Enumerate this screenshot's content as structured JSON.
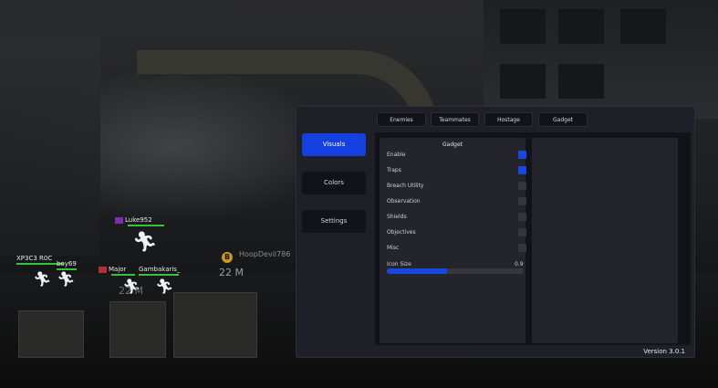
{
  "players": [
    {
      "name": "XP3C3 R0C",
      "name2": "boy69"
    },
    {
      "name": "Luke952"
    },
    {
      "name": "Major",
      "name2": "Gambakaris_"
    },
    {
      "name": "HoopDevil786"
    }
  ],
  "scene": {
    "distance_1": "22 M",
    "distance_2": "22 M",
    "objective_letter": "B"
  },
  "sidebar": {
    "items": [
      {
        "label": "Visuals",
        "active": true
      },
      {
        "label": "Colors",
        "active": false
      },
      {
        "label": "Settings",
        "active": false
      }
    ]
  },
  "tabs": [
    "Enemies",
    "Teammates",
    "Hostage",
    "Gadget"
  ],
  "gadget": {
    "title": "Gadget",
    "options": [
      {
        "label": "Enable",
        "checked": true
      },
      {
        "label": "Traps",
        "checked": true
      },
      {
        "label": "Breach Utility",
        "checked": false
      },
      {
        "label": "Observation",
        "checked": false
      },
      {
        "label": "Shields",
        "checked": false
      },
      {
        "label": "Objectives",
        "checked": false
      },
      {
        "label": "Misc",
        "checked": false
      }
    ],
    "slider": {
      "label": "Icon Size",
      "value": "0.9",
      "fraction": 0.44
    }
  },
  "version": "Version 3.0.1",
  "colors": {
    "accent": "#1848e0",
    "health": "#37c23a"
  }
}
